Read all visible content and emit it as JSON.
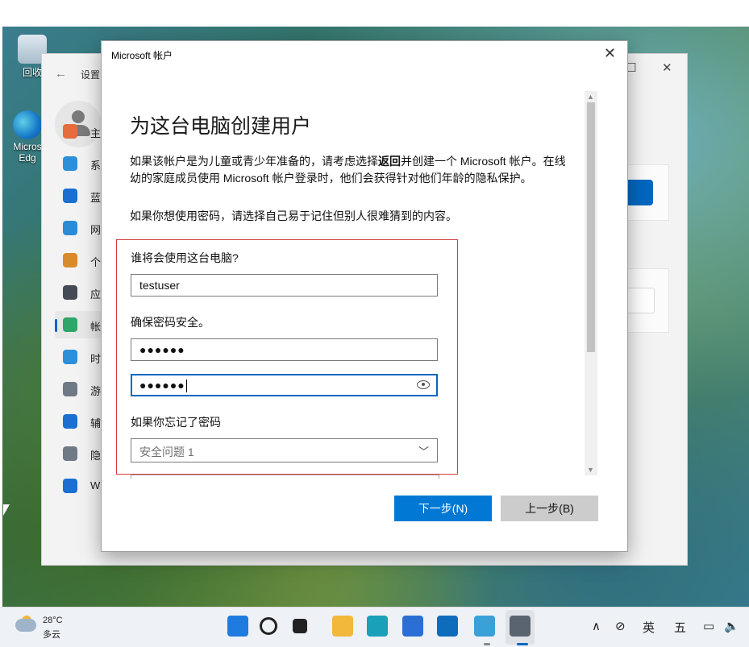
{
  "desktop": {
    "icons": [
      {
        "label": "回收"
      },
      {
        "label": "Micros"
      },
      {
        "label": "Edg"
      }
    ]
  },
  "settings": {
    "title": "设置",
    "back_icon": "←",
    "nav": [
      {
        "label": "主",
        "icon": "home-icon",
        "color": "#e66c3c"
      },
      {
        "label": "系",
        "icon": "display-icon",
        "color": "#2b8fd9"
      },
      {
        "label": "蓝",
        "icon": "bluetooth-icon",
        "color": "#1b6fd1"
      },
      {
        "label": "网",
        "icon": "wifi-icon",
        "color": "#2a8bd6"
      },
      {
        "label": "个",
        "icon": "brush-icon",
        "color": "#d98a2b"
      },
      {
        "label": "应",
        "icon": "apps-icon",
        "color": "#444b55"
      },
      {
        "label": "帐",
        "icon": "account-icon",
        "color": "#2fa56a"
      },
      {
        "label": "时",
        "icon": "clock-icon",
        "color": "#2b8fd9"
      },
      {
        "label": "游",
        "icon": "gamepad-icon",
        "color": "#6f7a86"
      },
      {
        "label": "辅",
        "icon": "accessibility-icon",
        "color": "#1b6fd1"
      },
      {
        "label": "隐",
        "icon": "shield-icon",
        "color": "#6f7a86"
      },
      {
        "label": "W",
        "icon": "update-icon",
        "color": "#1b6fd1"
      }
    ]
  },
  "dialog": {
    "window_title": "Microsoft 帐户",
    "close_glyph": "✕",
    "heading": "为这台电脑创建用户",
    "intro_line1_before": "如果该帐户是为儿童或青少年准备的，请考虑选择",
    "intro_line1_bold": "返回",
    "intro_line1_after": "并创建一个 Microsoft 帐户。在线",
    "intro_line2": "幼的家庭成员使用 Microsoft 帐户登录时，他们会获得针对他们年龄的隐私保护。",
    "password_hint": "如果你想使用密码，请选择自己易于记住但别人很难猜到的内容。",
    "who_label": "谁将会使用这台电脑?",
    "username_value": "testuser",
    "secure_label": "确保密码安全。",
    "password_value": "●●●●●●",
    "confirm_value": "●●●●●●",
    "forgot_label": "如果你忘记了密码",
    "security_question_value": "安全问题 1",
    "scroll_up": "▲",
    "scroll_down": "▼",
    "next_button": "下一步(N)",
    "back_button": "上一步(B)"
  },
  "taskbar": {
    "weather_temp": "28°C",
    "weather_cond": "多云",
    "tray_chevron": "∧",
    "ime_lang": "英",
    "ime_mode": "五",
    "apps": [
      {
        "name": "start-icon",
        "color": "#1f7be0"
      },
      {
        "name": "search-icon",
        "color": "#222"
      },
      {
        "name": "task-view-icon",
        "color": "#222"
      },
      {
        "name": "file-explorer-icon",
        "color": "#f2b83b"
      },
      {
        "name": "edge-icon",
        "color": "#1aa0b8"
      },
      {
        "name": "store-icon",
        "color": "#2a6fd6"
      },
      {
        "name": "outlook-icon",
        "color": "#0f6cbd"
      },
      {
        "name": "remote-desktop-icon",
        "color": "#3aa0d8"
      },
      {
        "name": "settings-icon",
        "color": "#5a6470"
      }
    ]
  }
}
